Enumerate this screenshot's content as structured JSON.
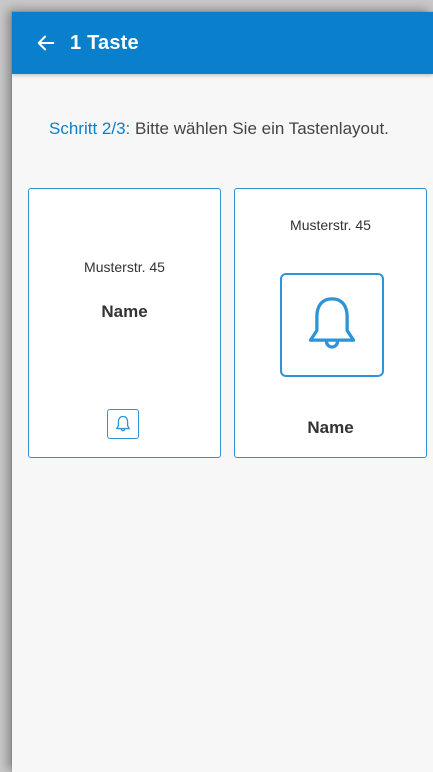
{
  "header": {
    "back_icon": "arrow-left-icon",
    "title": "1 Taste"
  },
  "instruction": {
    "step_label": "Schritt 2/3:",
    "text": " Bitte wählen Sie ein Tastenlayout."
  },
  "layouts": [
    {
      "address": "Musterstr. 45",
      "name": "Name",
      "icon": "bell-icon",
      "style": "small button"
    },
    {
      "address": "Musterstr. 45",
      "name": "Name",
      "icon": "bell-icon",
      "style": "large button"
    }
  ],
  "colors": {
    "accent": "#0a7fcb",
    "card_border": "#2d94d6",
    "background": "#f7f7f7"
  }
}
